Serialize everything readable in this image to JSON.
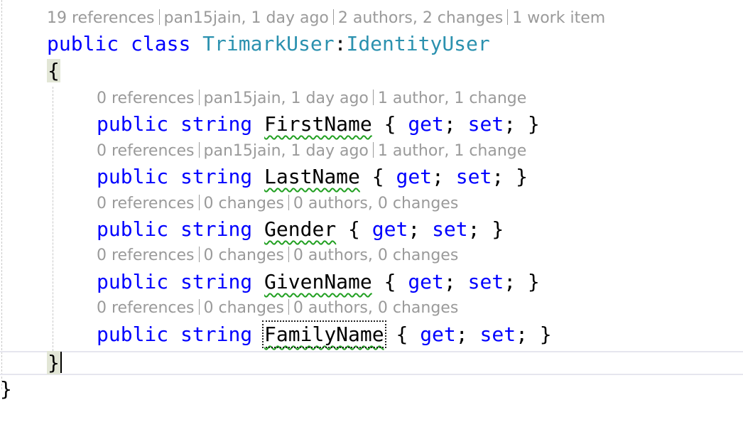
{
  "codelens": {
    "class_lens": {
      "refs": "19 references",
      "author": "pan15jain, 1 day ago",
      "changes": "2 authors, 2 changes",
      "work": "1 work item"
    },
    "firstname_lens": {
      "refs": "0 references",
      "author": "pan15jain, 1 day ago",
      "changes": "1 author, 1 change"
    },
    "lastname_lens": {
      "refs": "0 references",
      "author": "pan15jain, 1 day ago",
      "changes": "1 author, 1 change"
    },
    "gender_lens": {
      "refs": "0 references",
      "author": "0 changes",
      "changes": "0 authors, 0 changes"
    },
    "givenname_lens": {
      "refs": "0 references",
      "author": "0 changes",
      "changes": "0 authors, 0 changes"
    },
    "familyname_lens": {
      "refs": "0 references",
      "author": "0 changes",
      "changes": "0 authors, 0 changes"
    }
  },
  "code": {
    "kw_public": "public",
    "kw_class": "class",
    "kw_string": "string",
    "kw_get": "get",
    "kw_set": "set",
    "class_name": "TrimarkUser",
    "colon": ":",
    "base_class": "IdentityUser",
    "open_brace": "{",
    "close_brace": "}",
    "semicolon": ";",
    "props": [
      "FirstName",
      "LastName",
      "Gender",
      "GivenName",
      "FamilyName"
    ]
  },
  "colors": {
    "keyword": "#0000ff",
    "type": "#2b91af",
    "codelens": "#9a9a9a",
    "squiggle": "#22a022",
    "brace_highlight": "#e2e6d6"
  }
}
